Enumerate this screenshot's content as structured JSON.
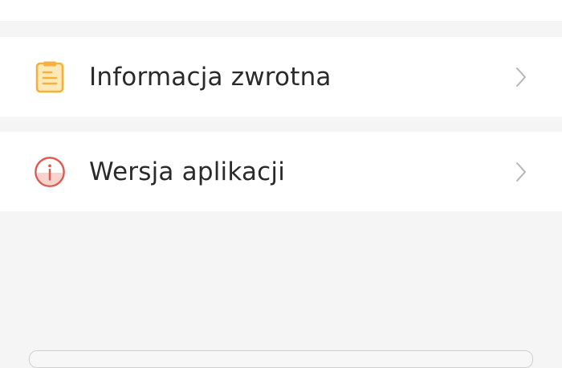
{
  "menu": {
    "items": [
      {
        "label": "Informacja zwrotna",
        "icon": "feedback-clipboard-icon",
        "icon_color": "#f5b13c"
      },
      {
        "label": "Wersja aplikacji",
        "icon": "app-version-info-icon",
        "icon_color": "#e05a4f"
      }
    ],
    "chevron_icon": "chevron-right-icon",
    "chevron_color": "#b5b5b5"
  },
  "colors": {
    "background": "#f5f5f5",
    "row_background": "#ffffff",
    "text": "#2a2a2a"
  }
}
